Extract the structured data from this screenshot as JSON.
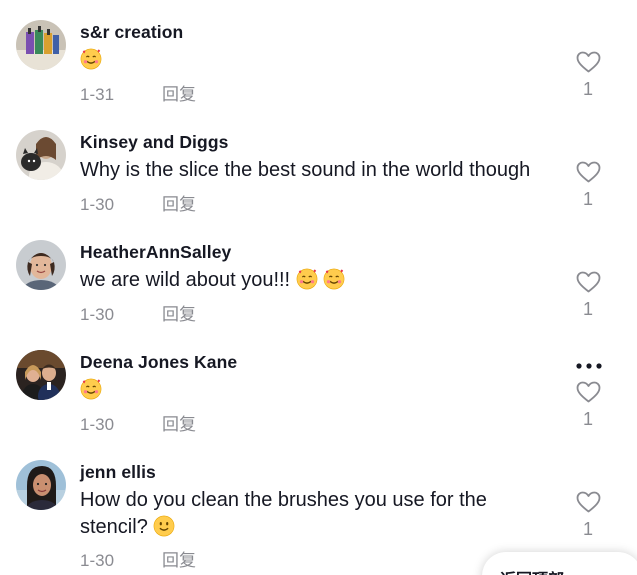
{
  "comments": [
    {
      "username": "s&r creation",
      "text": "",
      "emojis": [
        "smiling-face-with-hearts"
      ],
      "date": "1-31",
      "reply_label": "回复",
      "likes": "1"
    },
    {
      "username": "Kinsey and Diggs",
      "text": "Why is the slice the best sound in the world though",
      "emojis": [],
      "date": "1-30",
      "reply_label": "回复",
      "likes": "1"
    },
    {
      "username": "HeatherAnnSalley",
      "text": "we are wild about you!!! ",
      "emojis": [
        "smiling-face-with-hearts",
        "smiling-face-with-hearts"
      ],
      "date": "1-30",
      "reply_label": "回复",
      "likes": "1"
    },
    {
      "username": "Deena Jones Kane",
      "text": "",
      "emojis": [
        "smiling-face-with-hearts"
      ],
      "date": "1-30",
      "reply_label": "回复",
      "likes": "1",
      "show_more_icon": "more-dots-icon"
    },
    {
      "username": "jenn ellis",
      "text": "How do you clean the brushes you use for the stencil? ",
      "emojis": [
        "slightly-smiling-face"
      ],
      "date": "1-30",
      "reply_label": "回复",
      "likes": "1"
    }
  ],
  "back_to_top": {
    "label": "返回顶部"
  },
  "colors": {
    "text_primary": "#161823",
    "text_secondary": "#8a8b91",
    "background": "#ffffff"
  }
}
